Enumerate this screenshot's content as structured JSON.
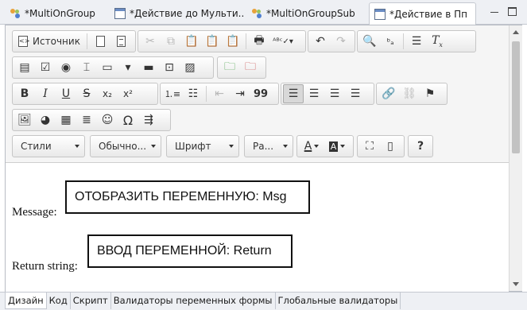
{
  "tabs": [
    {
      "label": "*MultiOnGroup",
      "icon": "flow-icon"
    },
    {
      "label": "*Действие до Мульти...",
      "icon": "form-icon"
    },
    {
      "label": "*MultiOnGroupSub",
      "icon": "flow-icon"
    },
    {
      "label": "*Действие в Пп",
      "icon": "form-icon",
      "active": true
    }
  ],
  "window": {
    "close_glyph": "✕"
  },
  "toolbar": {
    "source_label": "Источник",
    "styles_combo": "Стили",
    "format_combo": "Обычно...",
    "font_combo": "Шрифт",
    "size_combo": "Ра...",
    "font_color": "A",
    "bg_color": "A",
    "help": "?",
    "omega": "Ω",
    "quote": "99",
    "bold": "B",
    "italic": "I",
    "underline": "U",
    "strike": "S",
    "subscript": "x₂",
    "superscript": "x²"
  },
  "content": {
    "fields": [
      {
        "label": "Message:",
        "box_text": "ОТОБРАЗИТЬ ПЕРЕМЕННУЮ: Msg"
      },
      {
        "label": "Return string:",
        "box_text": "ВВОД ПЕРЕМЕННОЙ: Return"
      }
    ]
  },
  "bottom_tabs": [
    "Дизайн",
    "Код",
    "Скрипт",
    "Валидаторы переменных формы",
    "Глобальные валидаторы"
  ],
  "colors": {
    "accent": "#4f7fd0",
    "tab_bg": "#eef0f4",
    "toolbar_bg": "#f5f5f5"
  }
}
